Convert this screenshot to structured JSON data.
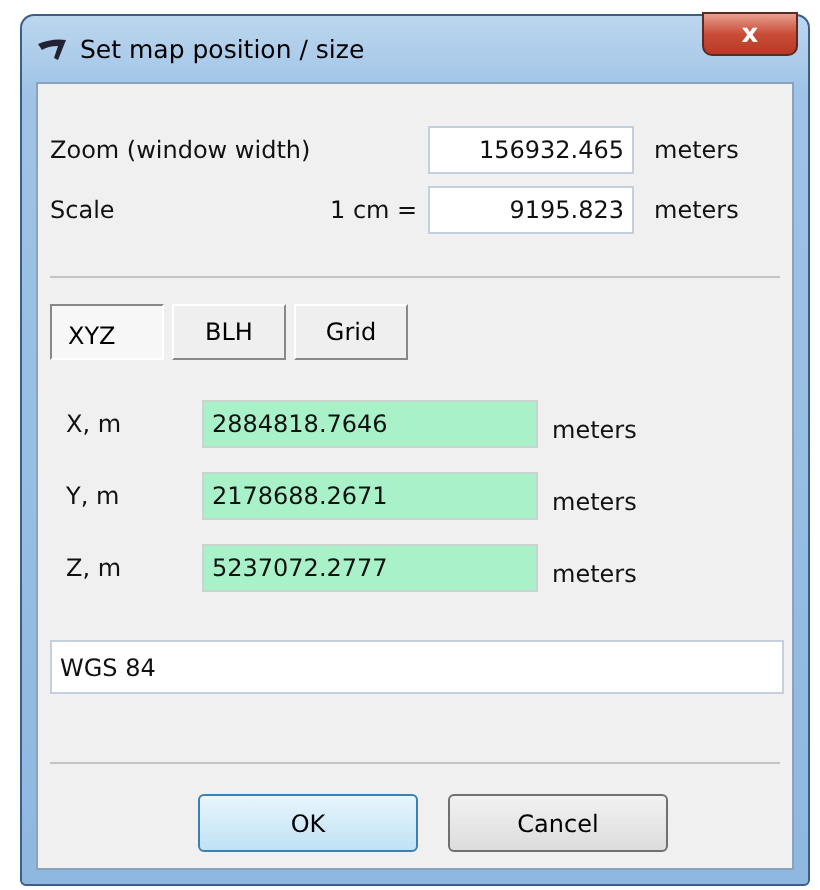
{
  "window": {
    "title": "Set map position / size",
    "close": "x"
  },
  "zoom": {
    "label": "Zoom (window width)",
    "value": "156932.465",
    "unit": "meters"
  },
  "scale": {
    "label": "Scale",
    "prefix": "1 cm =",
    "value": "9195.823",
    "unit": "meters"
  },
  "tabs": [
    {
      "label": "XYZ",
      "selected": true
    },
    {
      "label": "BLH",
      "selected": false
    },
    {
      "label": "Grid",
      "selected": false
    }
  ],
  "coords": [
    {
      "label": "X, m",
      "value": "2884818.7646",
      "unit": "meters"
    },
    {
      "label": "Y, m",
      "value": "2178688.2671",
      "unit": "meters"
    },
    {
      "label": "Z, m",
      "value": "5237072.2777",
      "unit": "meters"
    }
  ],
  "datum": {
    "value": "WGS 84"
  },
  "buttons": [
    {
      "label": "OK",
      "default": true
    },
    {
      "label": "Cancel",
      "default": false
    }
  ]
}
